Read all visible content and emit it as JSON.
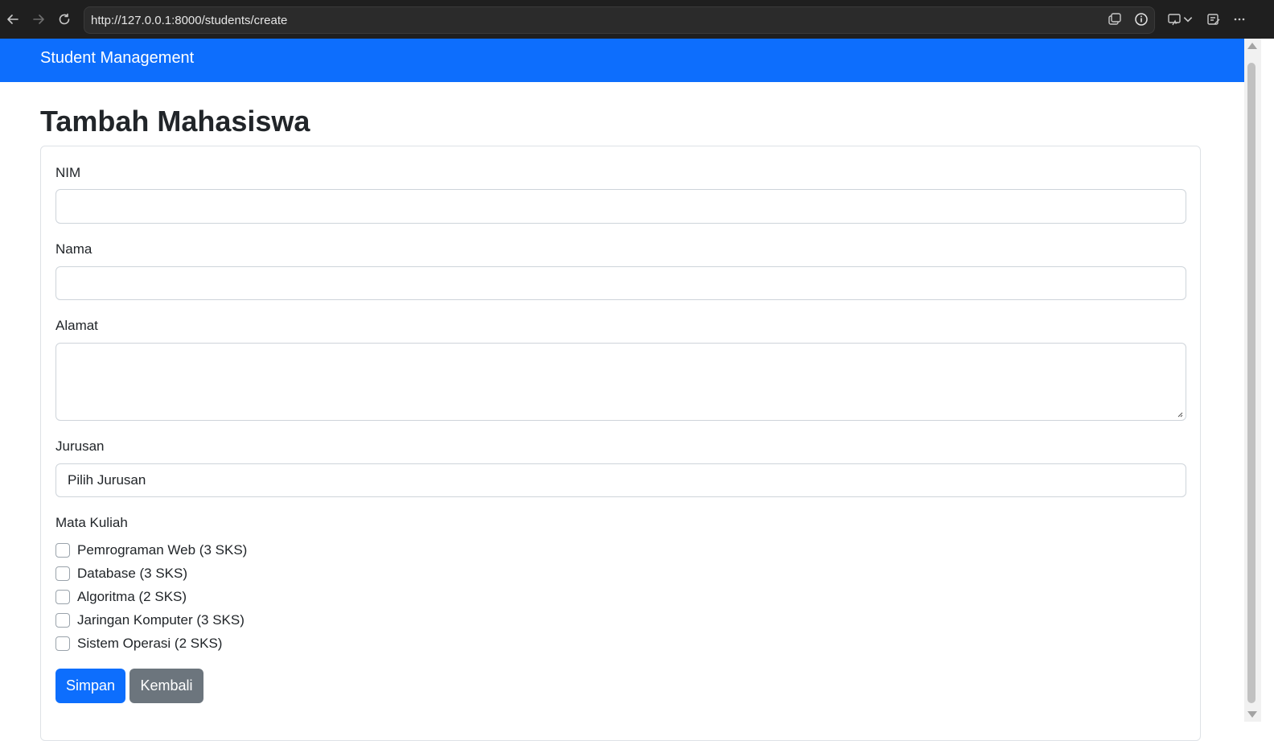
{
  "browser": {
    "url": "http://127.0.0.1:8000/students/create"
  },
  "navbar": {
    "brand": "Student Management"
  },
  "page": {
    "title": "Tambah Mahasiswa"
  },
  "form": {
    "nim": {
      "label": "NIM",
      "value": ""
    },
    "nama": {
      "label": "Nama",
      "value": ""
    },
    "alamat": {
      "label": "Alamat",
      "value": ""
    },
    "jurusan": {
      "label": "Jurusan",
      "selected": "Pilih Jurusan"
    },
    "mata_kuliah": {
      "label": "Mata Kuliah",
      "options": [
        {
          "label": "Pemrograman Web (3 SKS)",
          "checked": false
        },
        {
          "label": "Database (3 SKS)",
          "checked": false
        },
        {
          "label": "Algoritma (2 SKS)",
          "checked": false
        },
        {
          "label": "Jaringan Komputer (3 SKS)",
          "checked": false
        },
        {
          "label": "Sistem Operasi (2 SKS)",
          "checked": false
        }
      ]
    },
    "buttons": {
      "save": "Simpan",
      "back": "Kembali"
    }
  },
  "colors": {
    "primary": "#0d6efd",
    "secondary": "#6c757d",
    "browser_chrome": "#1f1f1f"
  },
  "icons": [
    "back-arrow-icon",
    "forward-arrow-icon",
    "reload-icon",
    "tab-actions-icon",
    "site-info-icon",
    "cast-icon",
    "chevron-down-icon",
    "tools-icon",
    "more-menu-icon"
  ]
}
